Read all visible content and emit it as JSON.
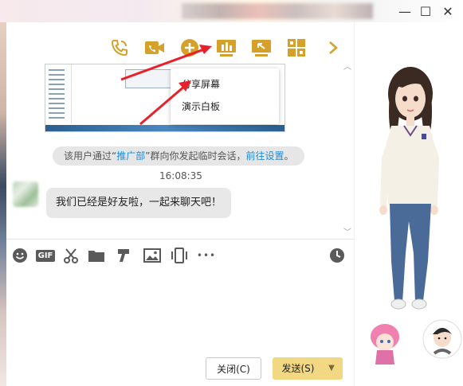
{
  "titlebar": {
    "minimize_glyph": "—",
    "maximize_glyph": "☐",
    "close_glyph": "✕"
  },
  "toolbar": {
    "icons": [
      "phone-icon",
      "video-call-icon",
      "add-icon",
      "share-screen-icon",
      "remote-assist-icon",
      "apps-icon",
      "more-chevron-icon"
    ],
    "accent": "#d6a12a"
  },
  "popup": {
    "items": [
      "分享屏幕",
      "演示白板"
    ]
  },
  "chat": {
    "notice_prefix": "该用户通过“",
    "notice_group": "推广部",
    "notice_middle": "”群向你发起临时会话，",
    "notice_link": "前往设置",
    "notice_suffix": "。",
    "timestamp": "16:08:35",
    "message": "我们已经是好友啦，一起来聊天吧！"
  },
  "input_toolbar": {
    "icons": [
      "emoji-icon",
      "gif-icon",
      "scissors-icon",
      "folder-icon",
      "quick-reply-icon",
      "image-icon",
      "shake-icon",
      "more-dots-icon",
      "history-clock-icon"
    ],
    "gif_label": "GIF",
    "dots": "•••"
  },
  "buttons": {
    "close_label": "关闭(C)",
    "send_label": "发送(S)",
    "send_arrow": "▼"
  },
  "scroll": {
    "up": "︿",
    "down": "﹀"
  }
}
